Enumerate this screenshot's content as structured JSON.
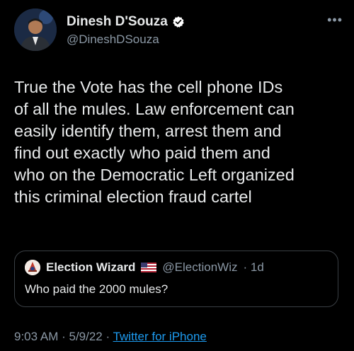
{
  "author": {
    "display_name": "Dinesh D'Souza",
    "handle": "@DineshDSouza",
    "verified": true,
    "avatar_icon": "profile-photo"
  },
  "menu": {
    "more_label": "•••"
  },
  "tweet": {
    "text": "True the Vote has the cell phone IDs\nof all the mules. Law enforcement can\neasily identify them, arrest them and\nfind out exactly who paid them and\nwho on the Democratic Left organized\nthis criminal election fraud cartel"
  },
  "quote": {
    "display_name": "Election Wizard",
    "handle": "@ElectionWiz",
    "time": "· 1d",
    "text": "Who paid the 2000 mules?",
    "flag_icon": "us-flag-icon"
  },
  "meta": {
    "time": "9:03 AM",
    "date": "· 5/9/22 ·",
    "source": "Twitter for iPhone"
  },
  "colors": {
    "background": "#000000",
    "text": "#e7e9ea",
    "muted": "#8b98a5",
    "link": "#1d9bf0",
    "verified": "#ffffff"
  }
}
